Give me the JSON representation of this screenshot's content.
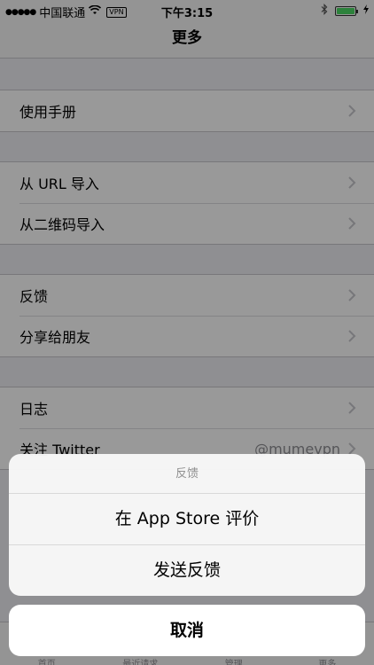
{
  "status_bar": {
    "signal": "●●●●●",
    "carrier": "中国联通",
    "vpn": "VPN",
    "time": "下午3:15"
  },
  "nav": {
    "title": "更多"
  },
  "sections": {
    "guide": {
      "items": [
        {
          "label": "使用手册"
        }
      ]
    },
    "import": {
      "items": [
        {
          "label": "从 URL 导入"
        },
        {
          "label": "从二维码导入"
        }
      ]
    },
    "feedback": {
      "items": [
        {
          "label": "反馈"
        },
        {
          "label": "分享给朋友"
        }
      ]
    },
    "misc": {
      "items": [
        {
          "label": "日志"
        },
        {
          "label": "关注 Twitter",
          "detail": "@mumevpn"
        }
      ]
    }
  },
  "tabs": [
    {
      "label": "首页"
    },
    {
      "label": "最近请求"
    },
    {
      "label": "管理"
    },
    {
      "label": "更多"
    }
  ],
  "action_sheet": {
    "title": "反馈",
    "buttons": [
      {
        "label": "在 App Store 评价"
      },
      {
        "label": "发送反馈"
      }
    ],
    "cancel": "取消"
  },
  "colors": {
    "battery": "#4cd964",
    "background": "#efeff4",
    "detail_text": "#8e8e93"
  },
  "icons": {
    "wifi": "wifi-icon",
    "bluetooth": "bluetooth-icon",
    "chevron": "chevron-right-icon"
  }
}
